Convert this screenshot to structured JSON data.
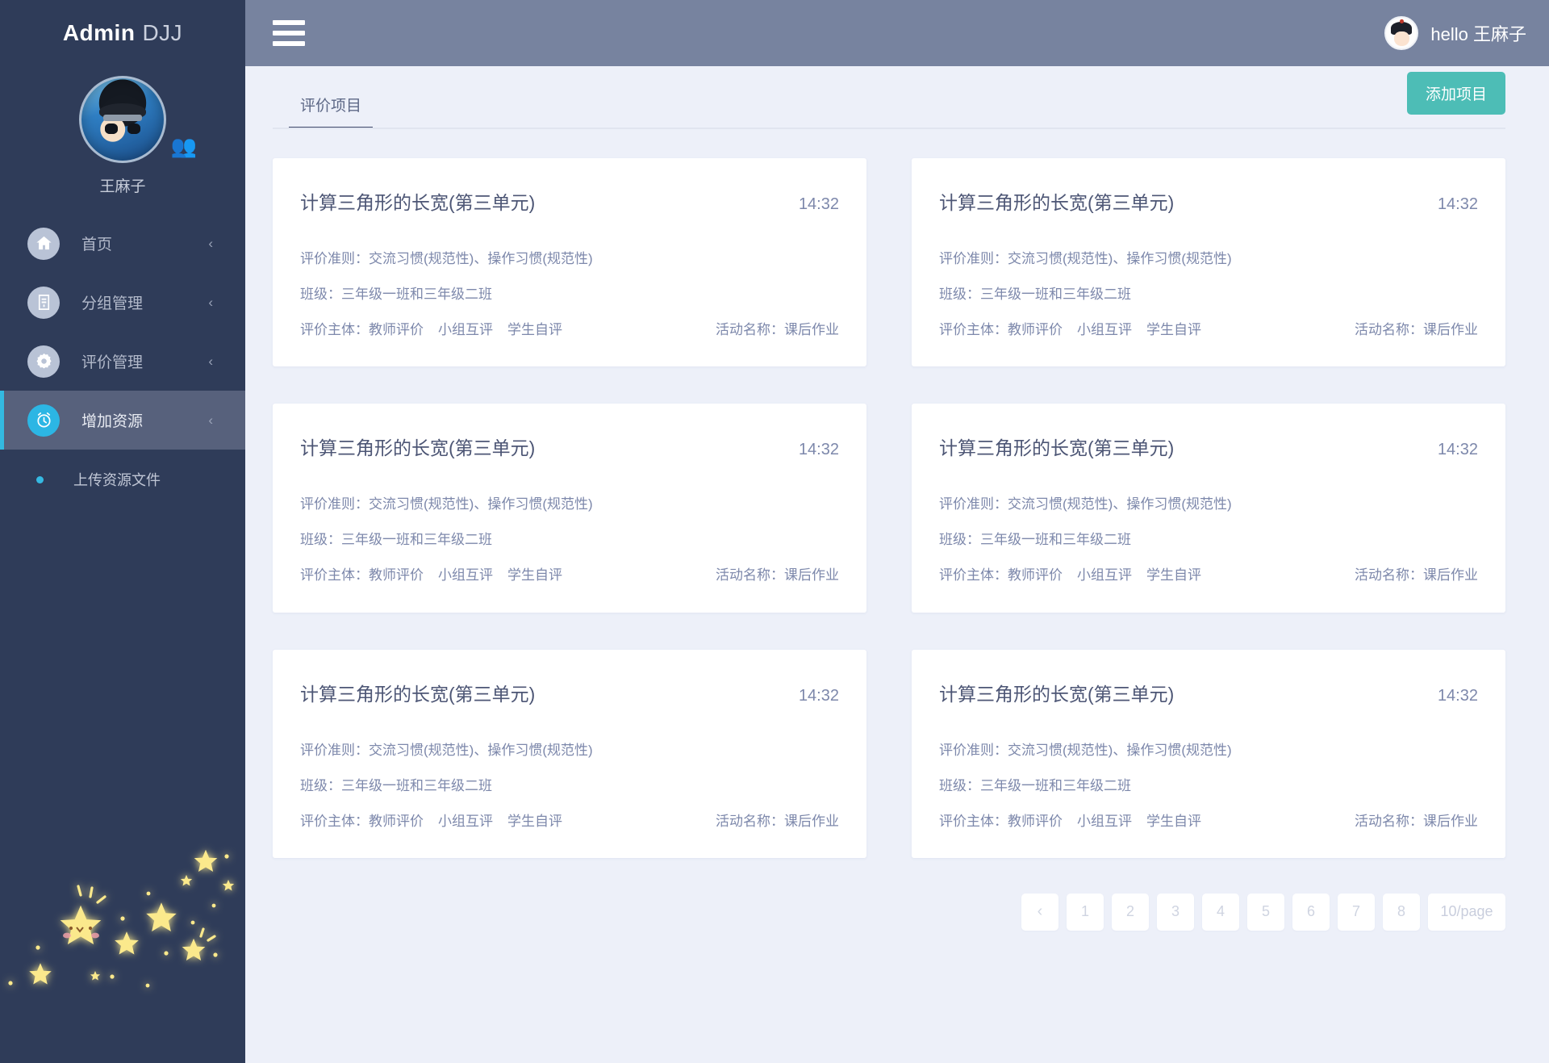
{
  "sidebar": {
    "brand": {
      "strong": "Admin",
      "light": "DJJ"
    },
    "profile": {
      "name": "王麻子",
      "avatar_icon": "user-avatar-hooded-boy",
      "people_icon": "people-icon"
    },
    "items": [
      {
        "label": "首页",
        "icon": "home-icon",
        "chevron": "‹",
        "active": false
      },
      {
        "label": "分组管理",
        "icon": "clipboard-icon",
        "chevron": "‹",
        "active": false
      },
      {
        "label": "评价管理",
        "icon": "gear-icon",
        "chevron": "‹",
        "active": false
      },
      {
        "label": "增加资源",
        "icon": "alarm-clock-icon",
        "chevron": "‹",
        "active": true
      }
    ],
    "sub_items": [
      {
        "label": "上传资源文件",
        "bullet": "•"
      }
    ],
    "decoration": "glowing-stars"
  },
  "topbar": {
    "menu_icon": "hamburger-icon",
    "greeting": "hello 王麻子",
    "avatar_icon": "user-avatar-qing-hat"
  },
  "tabs": [
    {
      "label": "评价项目",
      "active": true
    }
  ],
  "toolbar": {
    "add_label": "添加项目"
  },
  "cards": [
    {
      "title": "计算三角形的长宽(第三单元)",
      "time": "14:32",
      "criteria_label": "评价准则：",
      "criteria_value": "交流习惯(规范性)、操作习惯(规范性)",
      "class_label": "班级：",
      "class_value": "三年级一班和三年级二班",
      "subject_label": "评价主体：",
      "subjects": [
        "教师评价",
        "小组互评",
        "学生自评"
      ],
      "activity_label": "活动名称：",
      "activity_value": "课后作业"
    },
    {
      "title": "计算三角形的长宽(第三单元)",
      "time": "14:32",
      "criteria_label": "评价准则：",
      "criteria_value": "交流习惯(规范性)、操作习惯(规范性)",
      "class_label": "班级：",
      "class_value": "三年级一班和三年级二班",
      "subject_label": "评价主体：",
      "subjects": [
        "教师评价",
        "小组互评",
        "学生自评"
      ],
      "activity_label": "活动名称：",
      "activity_value": "课后作业"
    },
    {
      "title": "计算三角形的长宽(第三单元)",
      "time": "14:32",
      "criteria_label": "评价准则：",
      "criteria_value": "交流习惯(规范性)、操作习惯(规范性)",
      "class_label": "班级：",
      "class_value": "三年级一班和三年级二班",
      "subject_label": "评价主体：",
      "subjects": [
        "教师评价",
        "小组互评",
        "学生自评"
      ],
      "activity_label": "活动名称：",
      "activity_value": "课后作业"
    },
    {
      "title": "计算三角形的长宽(第三单元)",
      "time": "14:32",
      "criteria_label": "评价准则：",
      "criteria_value": "交流习惯(规范性)、操作习惯(规范性)",
      "class_label": "班级：",
      "class_value": "三年级一班和三年级二班",
      "subject_label": "评价主体：",
      "subjects": [
        "教师评价",
        "小组互评",
        "学生自评"
      ],
      "activity_label": "活动名称：",
      "activity_value": "课后作业"
    },
    {
      "title": "计算三角形的长宽(第三单元)",
      "time": "14:32",
      "criteria_label": "评价准则：",
      "criteria_value": "交流习惯(规范性)、操作习惯(规范性)",
      "class_label": "班级：",
      "class_value": "三年级一班和三年级二班",
      "subject_label": "评价主体：",
      "subjects": [
        "教师评价",
        "小组互评",
        "学生自评"
      ],
      "activity_label": "活动名称：",
      "activity_value": "课后作业"
    },
    {
      "title": "计算三角形的长宽(第三单元)",
      "time": "14:32",
      "criteria_label": "评价准则：",
      "criteria_value": "交流习惯(规范性)、操作习惯(规范性)",
      "class_label": "班级：",
      "class_value": "三年级一班和三年级二班",
      "subject_label": "评价主体：",
      "subjects": [
        "教师评价",
        "小组互评",
        "学生自评"
      ],
      "activity_label": "活动名称：",
      "activity_value": "课后作业"
    }
  ],
  "pagination": {
    "prev_icon": "‹",
    "pages": [
      "1",
      "2",
      "3",
      "4",
      "5",
      "6",
      "7",
      "8"
    ],
    "page_size": "10/page"
  },
  "colors": {
    "sidebar_bg": "#2f3c59",
    "sidebar_active_bg": "#57617c",
    "accent_cyan": "#2cb6e4",
    "topbar_bg": "#77839f",
    "page_bg": "#edf0f9",
    "button_teal": "#4dbdb6",
    "card_bg": "#ffffff",
    "text_muted": "#7d88ab"
  }
}
